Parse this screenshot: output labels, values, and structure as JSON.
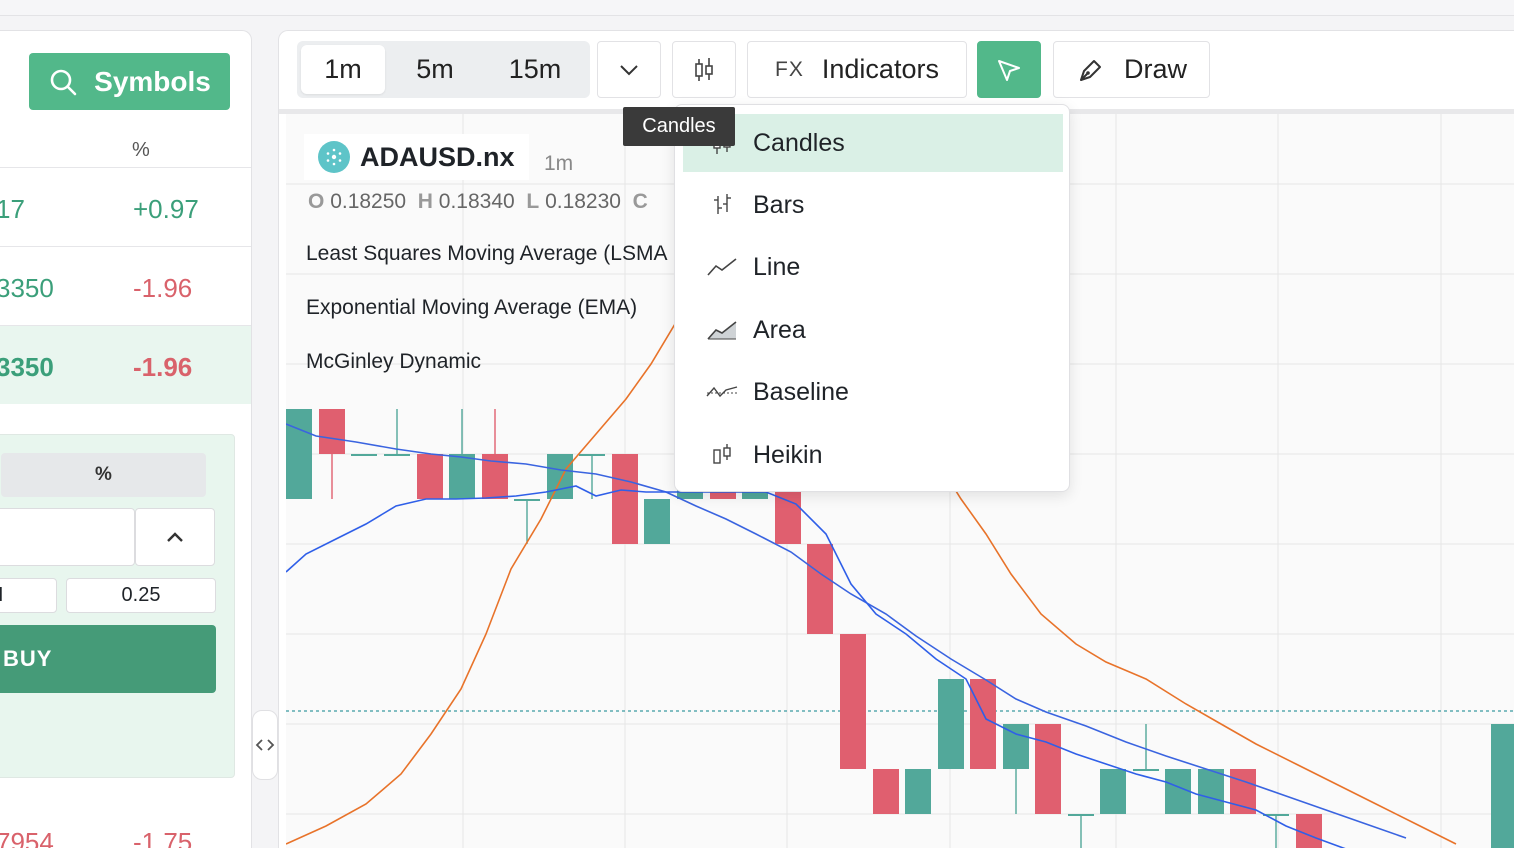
{
  "symbols_button": {
    "label": "Symbols"
  },
  "watchlist": {
    "pct_header": "%",
    "rows": [
      {
        "bid": "17",
        "change": "+0.97",
        "dir": "pos",
        "selected": false
      },
      {
        "bid": "3350",
        "change": "-1.96",
        "dir": "neg",
        "selected": false
      },
      {
        "bid": "3350",
        "change": "-1.96",
        "dir": "pos",
        "selected": true
      },
      {
        "bid": "7954",
        "change": "-1.75",
        "dir": "neg",
        "selected": false
      }
    ]
  },
  "order": {
    "pct_tab": "%",
    "chip_a": "I",
    "chip_b": "0.25",
    "buy_label": "BUY"
  },
  "toolbar": {
    "timeframes": [
      "1m",
      "5m",
      "15m"
    ],
    "active_timeframe": "1m",
    "fx_label": "FX",
    "indicators_label": "Indicators",
    "draw_label": "Draw"
  },
  "tooltip": {
    "text": "Candles"
  },
  "legend": {
    "symbol": "ADAUSD.nx",
    "timeframe": "1m",
    "ohlc": [
      {
        "k": "O",
        "v": "0.18250"
      },
      {
        "k": "H",
        "v": "0.18340"
      },
      {
        "k": "L",
        "v": "0.18230"
      },
      {
        "k": "C",
        "v": ""
      }
    ],
    "indicators": [
      "Least Squares Moving Average (LSMA",
      "Exponential Moving Average (EMA)",
      "McGinley Dynamic"
    ]
  },
  "chart_type_menu": {
    "items": [
      {
        "label": "Candles",
        "icon": "candles-icon",
        "selected": true
      },
      {
        "label": "Bars",
        "icon": "bars-icon",
        "selected": false
      },
      {
        "label": "Line",
        "icon": "line-icon",
        "selected": false
      },
      {
        "label": "Area",
        "icon": "area-icon",
        "selected": false
      },
      {
        "label": "Baseline",
        "icon": "baseline-icon",
        "selected": false
      },
      {
        "label": "Heikin",
        "icon": "heikin-icon",
        "selected": false
      }
    ]
  },
  "colors": {
    "accent": "#52b88a",
    "up": "#52a89a",
    "down": "#e05f6f",
    "ema": "#e8732a",
    "lsma": "#3a64e0"
  }
}
